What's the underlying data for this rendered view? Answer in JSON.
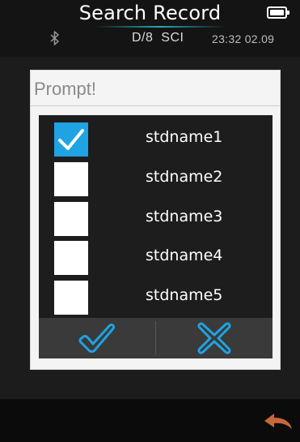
{
  "header": {
    "title": "Search Record",
    "status_mode": "D/8  SCI",
    "status_time": "23:32 02.09",
    "icons": [
      "bluetooth-icon",
      "battery-icon"
    ]
  },
  "dialog": {
    "title": "Prompt!",
    "items": [
      {
        "label": "stdname1",
        "checked": true
      },
      {
        "label": "stdname2",
        "checked": false
      },
      {
        "label": "stdname3",
        "checked": false
      },
      {
        "label": "stdname4",
        "checked": false
      },
      {
        "label": "stdname5",
        "checked": false
      }
    ],
    "buttons": {
      "ok_icon": "checkmark-icon",
      "cancel_icon": "x-icon"
    }
  },
  "footer": {
    "back_icon": "back-arrow-icon"
  },
  "colors": {
    "accent": "#1fa3e3",
    "back_arrow": "#c8683a"
  }
}
